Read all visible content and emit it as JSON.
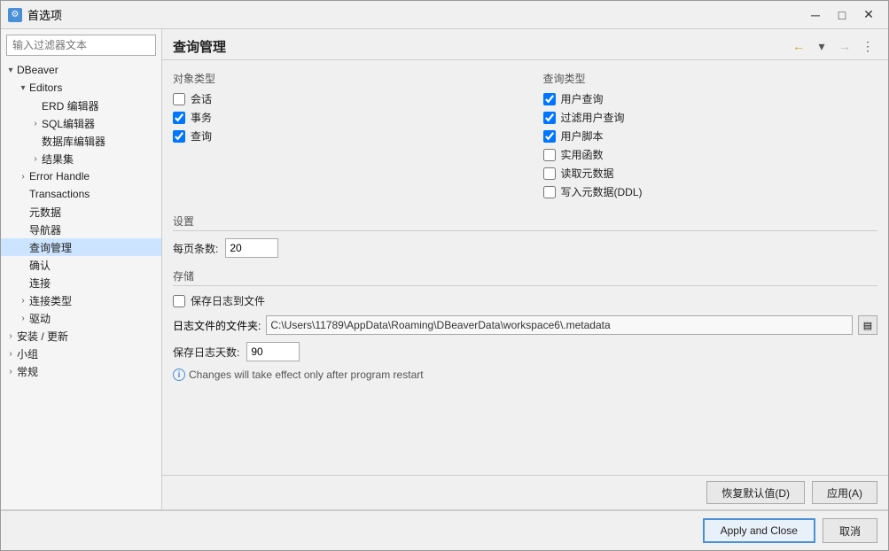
{
  "window": {
    "title": "首选项",
    "minimize_label": "─",
    "maximize_label": "□",
    "close_label": "✕"
  },
  "sidebar": {
    "filter_placeholder": "输入过滤器文本",
    "items": [
      {
        "id": "dbeaver",
        "label": "DBeaver",
        "level": 0,
        "expandable": true,
        "expanded": true
      },
      {
        "id": "editors",
        "label": "Editors",
        "level": 1,
        "expandable": true,
        "expanded": true
      },
      {
        "id": "erd-editor",
        "label": "ERD 编辑器",
        "level": 2,
        "expandable": false
      },
      {
        "id": "sql-editor",
        "label": "SQL编辑器",
        "level": 2,
        "expandable": true
      },
      {
        "id": "db-editor",
        "label": "数据库编辑器",
        "level": 2,
        "expandable": false
      },
      {
        "id": "results",
        "label": "结果集",
        "level": 2,
        "expandable": true
      },
      {
        "id": "error-handle",
        "label": "Error Handle",
        "level": 1,
        "expandable": true
      },
      {
        "id": "transactions",
        "label": "Transactions",
        "level": 1,
        "expandable": false
      },
      {
        "id": "metadata",
        "label": "元数据",
        "level": 1,
        "expandable": false
      },
      {
        "id": "navigator",
        "label": "导航器",
        "level": 1,
        "expandable": false
      },
      {
        "id": "query-mgmt",
        "label": "查询管理",
        "level": 1,
        "expandable": false,
        "selected": true
      },
      {
        "id": "confirm",
        "label": "确认",
        "level": 1,
        "expandable": false
      },
      {
        "id": "connect",
        "label": "连接",
        "level": 1,
        "expandable": false
      },
      {
        "id": "connect-type",
        "label": "连接类型",
        "level": 1,
        "expandable": true
      },
      {
        "id": "drivers",
        "label": "驱动",
        "level": 1,
        "expandable": true
      },
      {
        "id": "install-update",
        "label": "安装 / 更新",
        "level": 0,
        "expandable": true
      },
      {
        "id": "groups",
        "label": "小组",
        "level": 0,
        "expandable": true
      },
      {
        "id": "general",
        "label": "常规",
        "level": 0,
        "expandable": true
      }
    ]
  },
  "panel": {
    "title": "查询管理",
    "toolbar": {
      "back_title": "←",
      "dropdown_title": "▾",
      "forward_title": "→",
      "menu_title": "⋮"
    },
    "object_types": {
      "section_title": "对象类型",
      "items": [
        {
          "id": "session",
          "label": "会话",
          "checked": false
        },
        {
          "id": "transaction",
          "label": "事务",
          "checked": true
        },
        {
          "id": "query",
          "label": "查询",
          "checked": true
        }
      ]
    },
    "query_types": {
      "section_title": "查询类型",
      "items": [
        {
          "id": "user-query",
          "label": "用户查询",
          "checked": true
        },
        {
          "id": "filter-user-query",
          "label": "过滤用户查询",
          "checked": true
        },
        {
          "id": "user-script",
          "label": "用户脚本",
          "checked": true
        },
        {
          "id": "utility-func",
          "label": "实用函数",
          "checked": false
        },
        {
          "id": "read-metadata",
          "label": "读取元数据",
          "checked": false
        },
        {
          "id": "write-metadata",
          "label": "写入元数据(DDL)",
          "checked": false
        }
      ]
    },
    "settings": {
      "section_title": "设置",
      "per_page_label": "每页条数:",
      "per_page_value": "20"
    },
    "storage": {
      "section_title": "存储",
      "save_log_label": "保存日志到文件",
      "save_log_checked": false,
      "log_file_label": "日志文件的文件夹:",
      "log_file_path": "C:\\Users\\11789\\AppData\\Roaming\\DBeaverData\\workspace6\\.metadata",
      "save_days_label": "保存日志天数:",
      "save_days_value": "90",
      "info_text": "Changes will take effect only after program restart"
    },
    "footer": {
      "restore_btn": "恢复默认值(D)",
      "apply_btn": "应用(A)"
    }
  },
  "action_bar": {
    "apply_close_btn": "Apply and Close",
    "cancel_btn": "取消"
  }
}
